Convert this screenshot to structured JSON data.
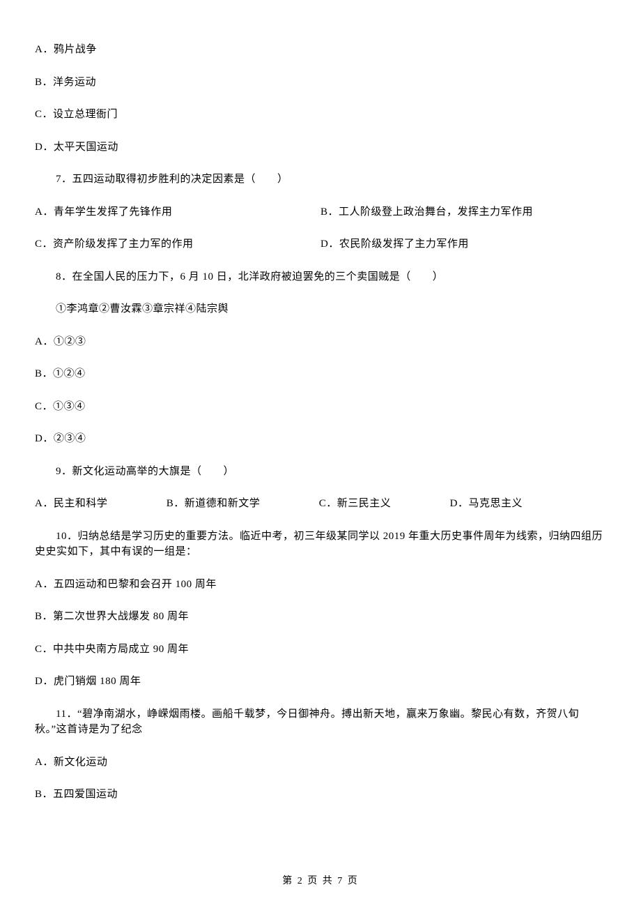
{
  "q6_opts": {
    "a": "A．鸦片战争",
    "b": "B．洋务运动",
    "c": "C．设立总理衙门",
    "d": "D．太平天国运动"
  },
  "q7": {
    "stem": "7．五四运动取得初步胜利的决定因素是（　　）",
    "a": "A．青年学生发挥了先锋作用",
    "b": "B．工人阶级登上政治舞台，发挥主力军作用",
    "c": "C．资产阶级发挥了主力军的作用",
    "d": "D．农民阶级发挥了主力军作用"
  },
  "q8": {
    "stem": "8．在全国人民的压力下，6 月 10 日，北洋政府被迫罢免的三个卖国贼是（　　）",
    "note": "①李鸿章②曹汝霖③章宗祥④陆宗舆",
    "a": "A．①②③",
    "b": "B．①②④",
    "c": "C．①③④",
    "d": "D．②③④"
  },
  "q9": {
    "stem": "9．新文化运动高举的大旗是（　　）",
    "a": "A．民主和科学",
    "b": "B．新道德和新文学",
    "c": "C．新三民主义",
    "d": "D．马克思主义"
  },
  "q10": {
    "stem": "10．归纳总结是学习历史的重要方法。临近中考，初三年级某同学以 2019 年重大历史事件周年为线索，归纳四组历史史实如下，其中有误的一组是：",
    "a": "A．五四运动和巴黎和会召开 100 周年",
    "b": "B．第二次世界大战爆发 80 周年",
    "c": "C．中共中央南方局成立 90 周年",
    "d": "D．虎门销烟 180 周年"
  },
  "q11": {
    "stem": "11．“碧净南湖水，峥嵘烟雨楼。画船千载梦，今日御神舟。搏出新天地，赢来万象幽。黎民心有数，齐贺八旬秋。”这首诗是为了纪念",
    "a": "A．新文化运动",
    "b": "B．五四爱国运动"
  },
  "footer": "第 2 页 共 7 页"
}
